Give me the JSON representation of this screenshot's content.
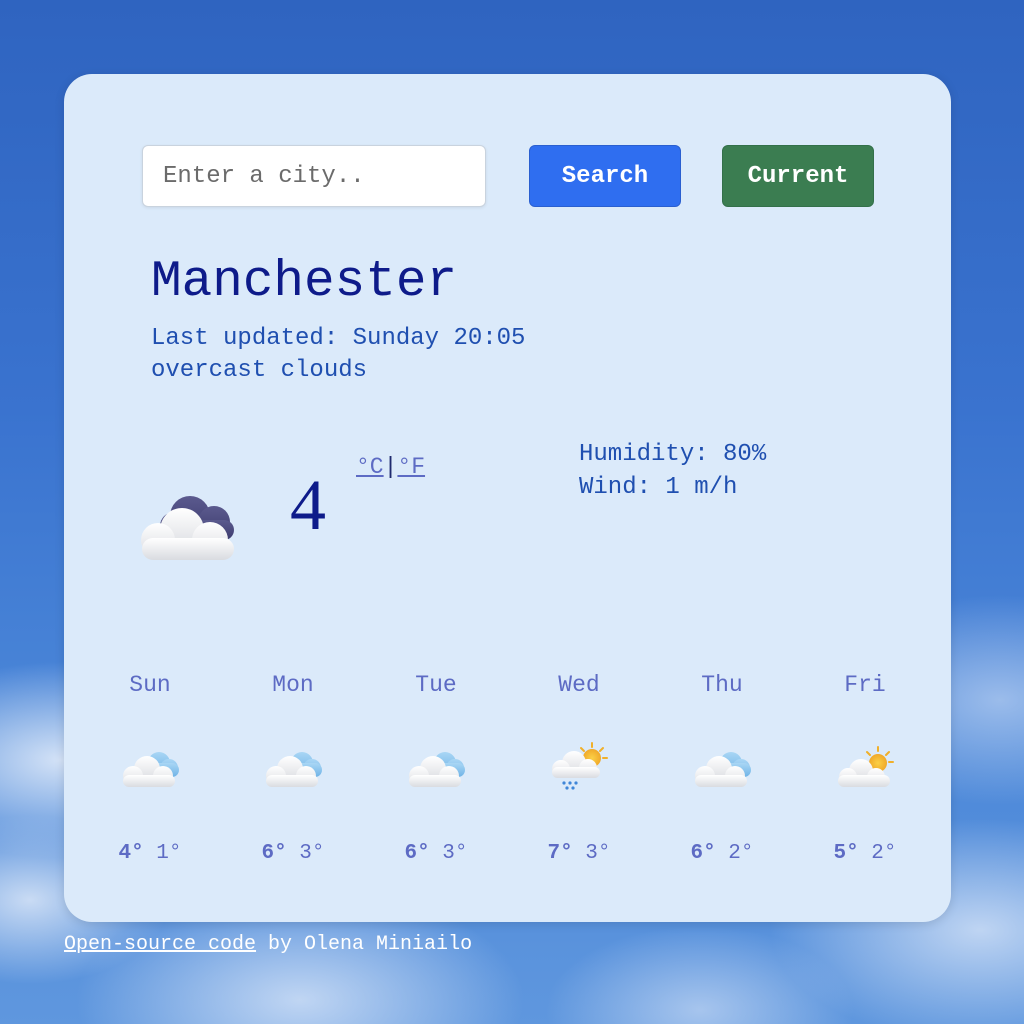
{
  "search": {
    "placeholder": "Enter a city..",
    "value": ""
  },
  "buttons": {
    "search_label": "Search",
    "current_label": "Current"
  },
  "weather": {
    "city": "Manchester",
    "last_updated": "Last updated: Sunday 20:05",
    "description": "overcast clouds",
    "temperature": "4",
    "unit_celsius": "°C",
    "unit_separator": "|",
    "unit_fahrenheit": "°F",
    "humidity": "Humidity: 80%",
    "wind": "Wind: 1 m/h",
    "icon": "overcast-clouds-icon"
  },
  "forecast": [
    {
      "day": "Sun",
      "max": "4°",
      "min": "1°",
      "icon": "cloudy-icon"
    },
    {
      "day": "Mon",
      "max": "6°",
      "min": "3°",
      "icon": "cloudy-icon"
    },
    {
      "day": "Tue",
      "max": "6°",
      "min": "3°",
      "icon": "cloudy-icon"
    },
    {
      "day": "Wed",
      "max": "7°",
      "min": "3°",
      "icon": "rain-sun-icon"
    },
    {
      "day": "Thu",
      "max": "6°",
      "min": "2°",
      "icon": "cloudy-icon"
    },
    {
      "day": "Fri",
      "max": "5°",
      "min": "2°",
      "icon": "partly-sunny-icon"
    }
  ],
  "footer": {
    "link_text": "Open-source code",
    "credit": " by Olena Miniailo"
  },
  "colors": {
    "accent_search": "#2f6ef0",
    "accent_current": "#3b7d51",
    "title": "#0e1b8a",
    "text": "#1f4fb0",
    "forecast": "#5d6bc4"
  }
}
